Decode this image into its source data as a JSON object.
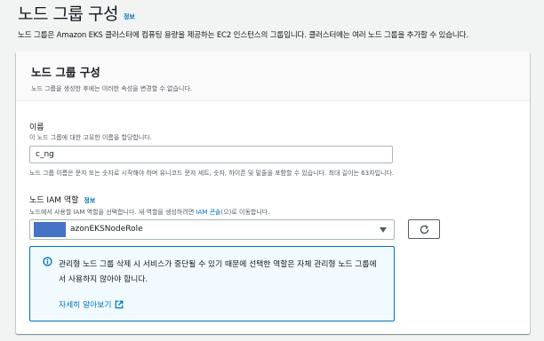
{
  "page": {
    "title": "노드 그룹 구성",
    "info_label": "정보",
    "description": "노드 그룹은 Amazon EKS 클러스터에 컴퓨팅 용량을 제공하는 EC2 인스턴스의 그룹입니다. 클러스터에는 여러 노드 그룹을 추가할 수 있습니다."
  },
  "section": {
    "title": "노드 그룹 구성",
    "description": "노드 그룹을 생성한 후에는 이러한 속성을 변경할 수 없습니다."
  },
  "name_field": {
    "label": "이름",
    "description": "이 노드 그룹에 대한 고유한 이름을 할당합니다.",
    "value": "c_ng",
    "constraint": "노드 그룹 이름은 문자 또는 숫자로 시작해야 하며 유니코드 문자 세트, 숫자, 하이픈 및 밑줄을 포함할 수 있습니다. 최대 길이는 63자입니다."
  },
  "iam_role": {
    "label": "노드 IAM 역할",
    "info_label": "정보",
    "description_prefix": "노드에서 사용할 IAM 역할을 선택합니다. 새 역할을 생성하려면 ",
    "description_link": "IAM 콘솔",
    "description_suffix": "(으)로 이동합니다.",
    "selected_value": "azonEKSNodeRole",
    "caret_icon": "caret-down-icon",
    "refresh_icon": "refresh-icon"
  },
  "alert": {
    "icon": "info-circle-icon",
    "message": "관리형 노드 그룹 삭제 시 서비스가 중단될 수 있기 때문에 선택한 역할은 자체 관리형 노드 그룹에서 사용하지 않아야 합니다.",
    "link": "자세히 알아보기",
    "link_icon": "external-link-icon"
  },
  "colors": {
    "accent": "#0073bb",
    "alert_bg": "#f1faff",
    "page_bg": "#f2f3f3",
    "redaction": "#4472c4"
  }
}
